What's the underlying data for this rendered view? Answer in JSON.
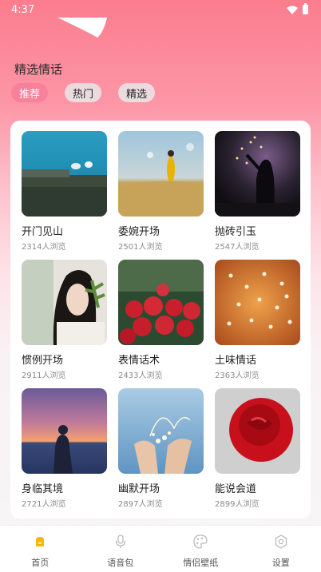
{
  "status": {
    "time": "4:37"
  },
  "section": {
    "title": "精选情话"
  },
  "tabs": [
    {
      "label": "推荐",
      "active": true
    },
    {
      "label": "热门",
      "active": false
    },
    {
      "label": "精选",
      "active": false
    }
  ],
  "items": [
    {
      "title": "开门见山",
      "views": "2314人浏览",
      "image": "seagulls-sea"
    },
    {
      "title": "委婉开场",
      "views": "2501人浏览",
      "image": "girl-yellow-dress-field"
    },
    {
      "title": "抛砖引玉",
      "views": "2547人浏览",
      "image": "silhouette-lights"
    },
    {
      "title": "惯例开场",
      "views": "2911人浏览",
      "image": "girl-with-leaves"
    },
    {
      "title": "表情话术",
      "views": "2433人浏览",
      "image": "red-roses"
    },
    {
      "title": "土味情话",
      "views": "2363人浏览",
      "image": "orange-flowers"
    },
    {
      "title": "身临其境",
      "views": "2721人浏览",
      "image": "sunset-silhouette"
    },
    {
      "title": "幽默开场",
      "views": "2897人浏览",
      "image": "hands-fairy-lights"
    },
    {
      "title": "能说会道",
      "views": "2899人浏览",
      "image": "single-red-rose"
    }
  ],
  "nav": [
    {
      "label": "首页",
      "icon": "home-icon",
      "active": true
    },
    {
      "label": "语音包",
      "icon": "microphone-icon",
      "active": false
    },
    {
      "label": "情侣壁纸",
      "icon": "palette-icon",
      "active": false
    },
    {
      "label": "设置",
      "icon": "settings-icon",
      "active": false
    }
  ],
  "colors": {
    "accent": "#f7819a",
    "nav_active": "#f5b800"
  }
}
